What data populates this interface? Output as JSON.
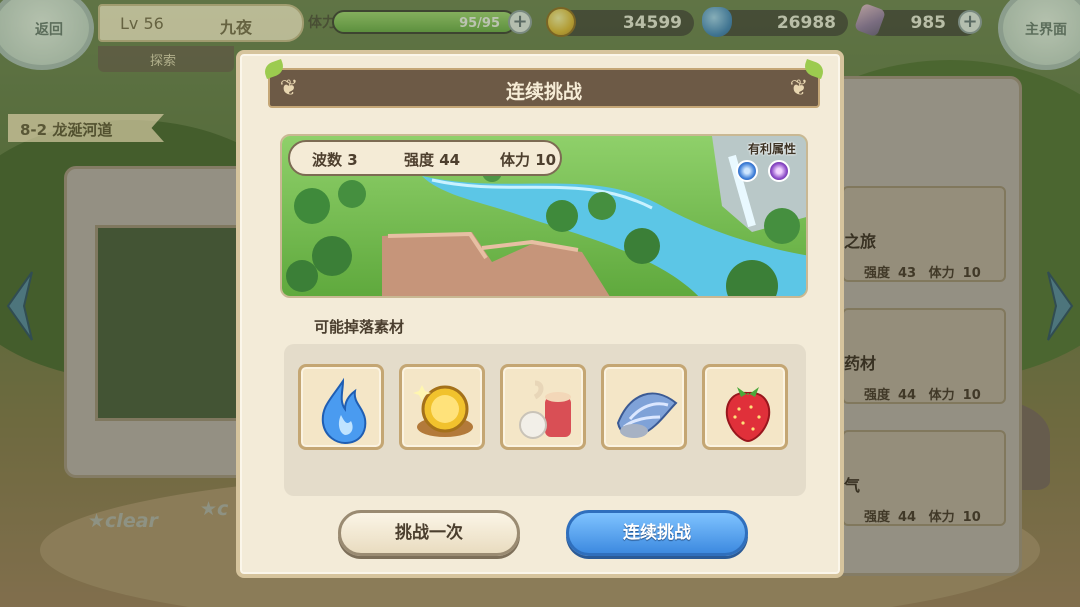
{
  "hud": {
    "back_label": "返回",
    "level": "Lv 56",
    "player_name": "九夜",
    "explore_tab": "探索",
    "stamina_label": "体力",
    "stamina_text": "95/95",
    "stamina_fraction": 1.0,
    "coins": "34599",
    "gems": "26988",
    "crystals": "985",
    "main_menu_label": "主界面"
  },
  "stage": {
    "tag": "8-2 龙涎河道"
  },
  "background_cards": [
    {
      "title": "之旅",
      "strength_label": "强度",
      "strength": "43",
      "stamina_label": "体力",
      "stamina": "10"
    },
    {
      "title": "药材",
      "strength_label": "强度",
      "strength": "44",
      "stamina_label": "体力",
      "stamina": "10"
    },
    {
      "title": "气",
      "strength_label": "强度",
      "strength": "44",
      "stamina_label": "体力",
      "stamina": "10"
    }
  ],
  "clear_labels": [
    "clear",
    "c"
  ],
  "dialog": {
    "title": "连续挑战",
    "waves": "波数 3",
    "strength": "强度 44",
    "stamina": "体力 10",
    "favorable_attr_label": "有利属性",
    "favorable_attrs": [
      "water-orb-icon",
      "dark-orb-icon"
    ],
    "drops_label": "可能掉落素材",
    "drops": [
      "blue-flame-icon",
      "gold-coin-icon",
      "thread-spool-icon",
      "seashell-icon",
      "strawberry-icon"
    ],
    "btn_once": "挑战一次",
    "btn_continuous": "连续挑战"
  },
  "colors": {
    "title_bar": "#6d5a46",
    "dialog_bg": "#f3ebd8",
    "continuous_button": "#3d8ae0"
  }
}
